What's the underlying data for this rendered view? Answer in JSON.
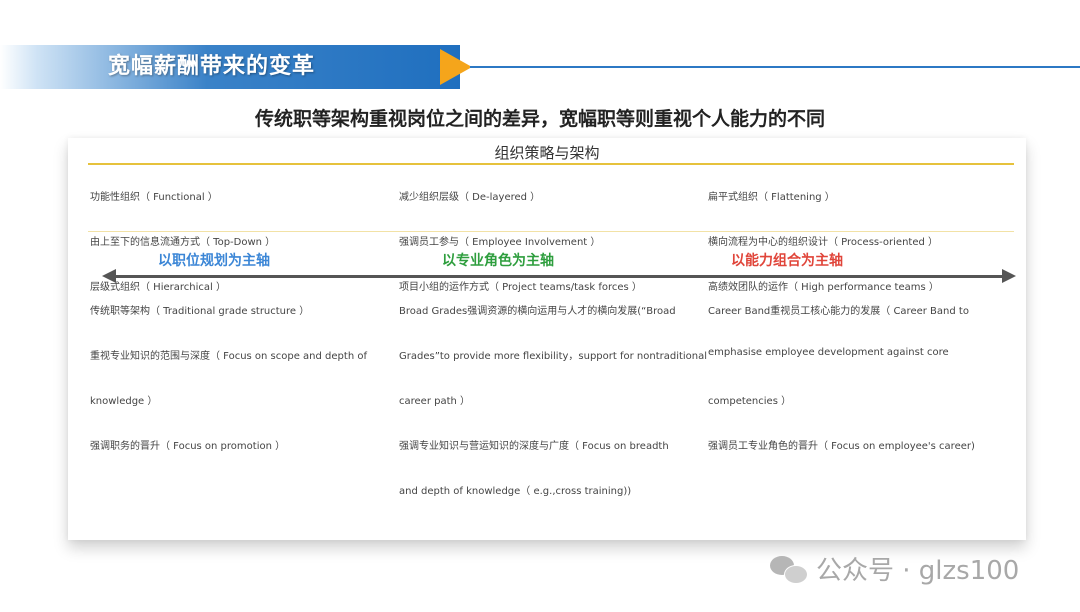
{
  "header": {
    "title": "宽幅薪酬带来的变革"
  },
  "headline": "传统职等架构重视岗位之间的差异，宽幅职等则重视个人能力的不同",
  "card": {
    "title": "组织策略与架构",
    "axis_labels": [
      {
        "text": "以职位规划为主轴",
        "color": "#3b86d6"
      },
      {
        "text": "以专业角色为主轴",
        "color": "#2e9e3e"
      },
      {
        "text": "以能力组合为主轴",
        "color": "#e0453a"
      }
    ],
    "columns": [
      {
        "org": [
          "功能性组织（ Functional ）",
          "由上至下的信息流通方式（ Top-Down ）",
          "层级式组织（ Hierarchical ）"
        ],
        "grade": [
          "传统职等架构（ Traditional grade structure ）",
          "重视专业知识的范围与深度（ Focus on scope and depth of",
          "knowledge ）",
          "强调职务的晋升（ Focus on promotion ）"
        ]
      },
      {
        "org": [
          "减少组织层级（ De-layered ）",
          "强调员工参与（ Employee Involvement ）",
          "项目小组的运作方式（ Project teams/task forces ）"
        ],
        "grade": [
          "Broad Grades强调资源的横向运用与人才的横向发展(“Broad",
          "Grades”to provide more flexibility，support for nontraditional",
          "career path ）",
          "强调专业知识与营运知识的深度与广度（ Focus on breadth",
          "and depth of knowledge（ e.g.,cross training))"
        ]
      },
      {
        "org": [
          "扁平式组织（ Flattening ）",
          "横向流程为中心的组织设计（ Process-oriented ）",
          "高绩效团队的运作（ High performance teams ）"
        ],
        "grade": [
          "Career Band重视员工核心能力的发展（ Career Band to",
          "emphasise employee development against core",
          "competencies ）",
          "强调员工专业角色的晋升（ Focus on employee's career)"
        ]
      }
    ]
  },
  "watermark": "公众号 · glzs100"
}
